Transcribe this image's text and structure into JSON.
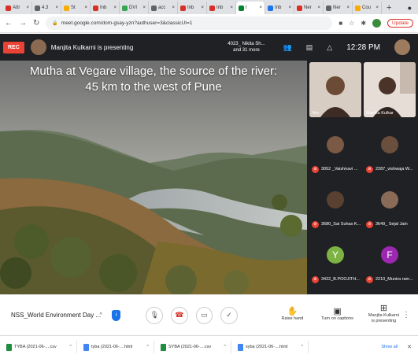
{
  "browser": {
    "tabs": [
      {
        "label": "Attr",
        "color": "#d93025"
      },
      {
        "label": "4.3",
        "color": "#5f6368"
      },
      {
        "label": "St",
        "color": "#f9ab00"
      },
      {
        "label": "Inb",
        "color": "#d93025"
      },
      {
        "label": "DVI",
        "color": "#34a853"
      },
      {
        "label": "acc",
        "color": "#5f6368"
      },
      {
        "label": "Inb",
        "color": "#d93025"
      },
      {
        "label": "Inb",
        "color": "#d93025"
      },
      {
        "label": "I",
        "color": "#00832d",
        "active": true
      },
      {
        "label": "Inb",
        "color": "#1a73e8"
      },
      {
        "label": "Ner",
        "color": "#d93025"
      },
      {
        "label": "Ner",
        "color": "#5f6368"
      },
      {
        "label": "Cou",
        "color": "#f9ab00"
      }
    ],
    "new_tab": "+",
    "url": "meet.google.com/dom-gsay-yzn?authuser=3&classicUI=1",
    "update_label": "Update"
  },
  "meet": {
    "rec_label": "REC",
    "presenting_banner": "Manjita Kulkarni is presenting",
    "participants_line1": "4023_ Nikita Sh...",
    "participants_line2": "and 31 more",
    "clock": "12:28 PM",
    "slide": {
      "line1": "Mutha at Vegare village, the source of the river:",
      "line2": "45 km to the west of Pune"
    },
    "self_label": "You",
    "presenter_label": "Manjita Kulkar",
    "tiles": [
      {
        "name": "3052 _Vaishnavi ...",
        "face": "photo",
        "color": "#7a5a45"
      },
      {
        "name": "2287_vishwaja W...",
        "face": "photo",
        "color": "#6b4f3d"
      },
      {
        "name": "3680_Sai Suhas K...",
        "face": "photo",
        "color": "#5a4030"
      },
      {
        "name": "3649_ Sejal Jain",
        "face": "photo",
        "color": "#8a6b58"
      },
      {
        "name": "3422_B.POOJITH...",
        "face": "letter",
        "letter": "Y",
        "color": "#7cb342"
      },
      {
        "name": "2210_Munira ram...",
        "face": "letter",
        "letter": "F",
        "color": "#9c27b0"
      }
    ]
  },
  "controls": {
    "meeting_name": "NSS_World Environment Day ...",
    "raise_hand": "Raise hand",
    "captions": "Turn on captions",
    "presenting_line1": "Manjita Kulkarni",
    "presenting_line2": "is presenting"
  },
  "downloads": {
    "items": [
      {
        "label": "TYBA (2021-06-....csv",
        "type": "csv"
      },
      {
        "label": "tyba (2021-06-....html",
        "type": "html"
      },
      {
        "label": "SYBA (2021-06-....csv",
        "type": "csv"
      },
      {
        "label": "syba (2021-06-....html",
        "type": "html"
      }
    ],
    "show_all": "Show all"
  }
}
